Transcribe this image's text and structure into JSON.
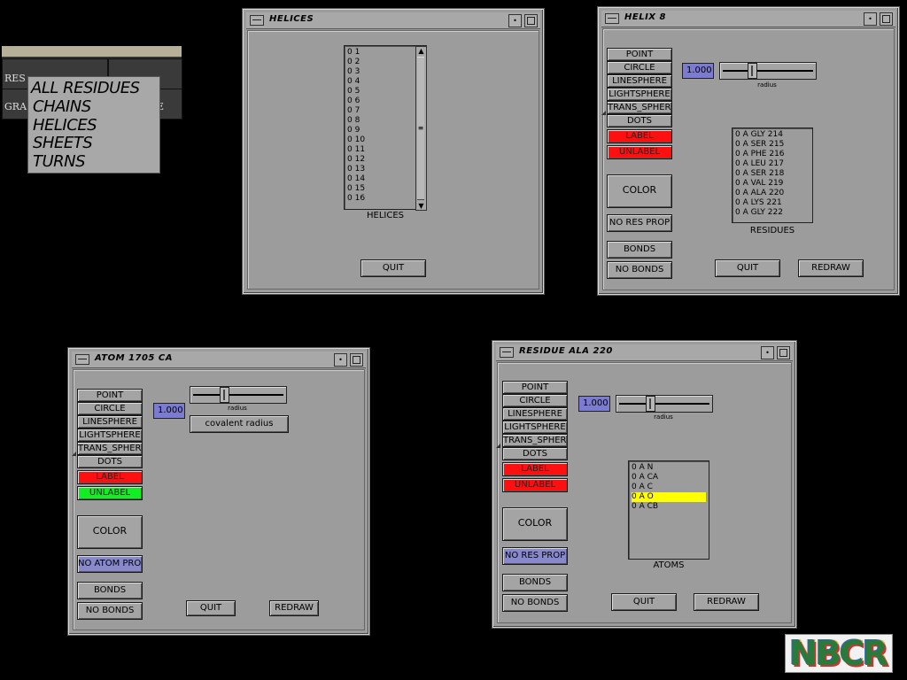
{
  "background_menu": {
    "peek_left_1": "RES",
    "peek_left_2": "GRA",
    "peek_right_2": "E",
    "items": [
      "ALL RESIDUES",
      "CHAINS",
      "HELICES",
      "SHEETS",
      "TURNS"
    ]
  },
  "helices_window": {
    "title": "HELICES",
    "list": [
      "0 1",
      "0 2",
      "0 3",
      "0 4",
      "0 5",
      "0 6",
      "0 7",
      "0 8",
      "0 9",
      "0 10",
      "0 11",
      "0 12",
      "0 13",
      "0 14",
      "0 15",
      "0 16"
    ],
    "list_caption": "HELICES",
    "quit_label": "QUIT"
  },
  "helix8_window": {
    "title": "HELIX  8",
    "style_buttons": [
      "POINT",
      "CIRCLE",
      "LINESPHERE",
      "LIGHTSPHERE",
      "TRANS_SPHERE",
      "DOTS"
    ],
    "label_button": "LABEL",
    "unlabel_button": "UNLABEL",
    "color_button": "COLOR",
    "prop_button": "NO RES PROP",
    "bonds_button": "BONDS",
    "no_bonds_button": "NO BONDS",
    "radius_value": "1.000",
    "radius_label": "radius",
    "residues": [
      "0 A GLY 214",
      "0 A SER 215",
      "0 A PHE 216",
      "0 A LEU 217",
      "0 A SER 218",
      "0 A VAL 219",
      "0 A ALA 220",
      "0 A LYS 221",
      "0 A GLY 222"
    ],
    "residues_caption": "RESIDUES",
    "quit_label": "QUIT",
    "redraw_label": "REDRAW"
  },
  "atom_window": {
    "title": "ATOM  1705 CA",
    "style_buttons": [
      "POINT",
      "CIRCLE",
      "LINESPHERE",
      "LIGHTSPHERE",
      "TRANS_SPHERE",
      "DOTS"
    ],
    "label_button": "LABEL",
    "unlabel_button": "UNLABEL",
    "color_button": "COLOR",
    "prop_button": "NO ATOM PROP",
    "bonds_button": "BONDS",
    "no_bonds_button": "NO BONDS",
    "radius_value": "1.000",
    "radius_label": "radius",
    "covalent_button": "covalent radius",
    "quit_label": "QUIT",
    "redraw_label": "REDRAW"
  },
  "residue_window": {
    "title": "RESIDUE  ALA 220",
    "style_buttons": [
      "POINT",
      "CIRCLE",
      "LINESPHERE",
      "LIGHTSPHERE",
      "TRANS_SPHERE",
      "DOTS"
    ],
    "label_button": "LABEL",
    "unlabel_button": "UNLABEL",
    "color_button": "COLOR",
    "prop_button": "NO RES PROP",
    "bonds_button": "BONDS",
    "no_bonds_button": "NO BONDS",
    "radius_value": "1.000",
    "radius_label": "radius",
    "atoms": [
      "0 A N",
      "0 A CA",
      "0 A C",
      "0 A O",
      "0 A CB"
    ],
    "selected_atom_index": 3,
    "atoms_caption": "ATOMS",
    "quit_label": "QUIT",
    "redraw_label": "REDRAW"
  },
  "logo": {
    "text": "NBCR"
  },
  "colors": {
    "label_red": "#ff1010",
    "unlabel_green": "#11ee22",
    "field_blue": "#7b7bd0",
    "selection_yellow": "#ffff00"
  }
}
